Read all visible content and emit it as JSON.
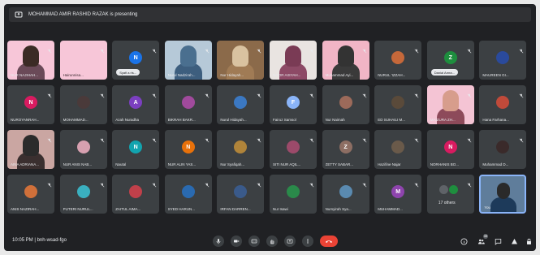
{
  "banner": {
    "text": "MOHAMMAD AMIR RASHID RAZAK is presenting"
  },
  "tiles": [
    {
      "name": "NUR NAJIHAH...",
      "kind": "video",
      "bg": "#f7c6d8",
      "face": "#3b2b25",
      "body": "#6a4a58"
    },
    {
      "name": "Hairunnisa...",
      "kind": "pink",
      "letter": "",
      "color": ""
    },
    {
      "name": "",
      "kind": "pill",
      "pill": "Syafi a ris...",
      "letter": "N",
      "color": "#1a73e8"
    },
    {
      "name": "Nurul Nadzirah...",
      "kind": "video",
      "bg": "#b6c9d8",
      "face": "#4a6f8f",
      "body": "#3d5e7e"
    },
    {
      "name": "Nur Hidayah...",
      "kind": "video",
      "bg": "#8b6a4a",
      "face": "#d9c2a0",
      "body": "#a07b55"
    },
    {
      "name": "NOOR AISYAH...",
      "kind": "video",
      "bg": "#e9e4e1",
      "face": "#7a3b55",
      "body": "#8d4a66"
    },
    {
      "name": "Muhammad Ayi...",
      "kind": "video",
      "bg": "#f1b5c6",
      "face": "#333",
      "body": "#3a3a3a"
    },
    {
      "name": "NURUL 'IZZAH...",
      "kind": "avatar",
      "letter": "",
      "color": "#c5683a"
    },
    {
      "name": "",
      "kind": "pill",
      "pill": "Danial Amra...",
      "letter": "Z",
      "color": "#1e8e3e"
    },
    {
      "name": "MAUREEN GI...",
      "kind": "avatar",
      "letter": "",
      "color": "#2a4a9c"
    },
    {
      "name": "NUROYANRAH...",
      "kind": "avatar",
      "letter": "N",
      "color": "#d81b60"
    },
    {
      "name": "MOHAMMAD...",
      "kind": "avatar",
      "letter": "",
      "color": "#4a3a3a"
    },
    {
      "name": "Azah Nuradha",
      "kind": "avatar",
      "letter": "A",
      "color": "#7b3fc0"
    },
    {
      "name": "BIKRAH BAKR...",
      "kind": "avatar",
      "letter": "",
      "color": "#a04a9c"
    },
    {
      "name": "Nurul Hidayah...",
      "kind": "avatar",
      "letter": "",
      "color": "#3b78c2"
    },
    {
      "name": "Fairuz Samsol",
      "kind": "avatar",
      "letter": "F",
      "color": "#8ab4f8"
    },
    {
      "name": "Nur Naimah",
      "kind": "avatar",
      "letter": "",
      "color": "#9c6a5a"
    },
    {
      "name": "ED SUHAILI M...",
      "kind": "avatar",
      "letter": "",
      "color": "#5a4a3a"
    },
    {
      "name": "MAIZURA ZH...",
      "kind": "video",
      "bg": "#f4c4d4",
      "face": "#d79d8c",
      "body": "#8d4a5a"
    },
    {
      "name": "Hana Farhana...",
      "kind": "avatar",
      "letter": "",
      "color": "#c04a3a"
    },
    {
      "name": "AINA ADRIANA...",
      "kind": "video",
      "bg": "#caa6a2",
      "face": "#2b2b2b",
      "body": "#3a2f2f"
    },
    {
      "name": "NUR ANIS NAB...",
      "kind": "avatar",
      "letter": "",
      "color": "#d7a0b0"
    },
    {
      "name": "Nautal",
      "kind": "avatar",
      "letter": "N",
      "color": "#12a4af"
    },
    {
      "name": "NUR ALIN YAS...",
      "kind": "avatar",
      "letter": "N",
      "color": "#e8710a"
    },
    {
      "name": "Nur Syafiqah...",
      "kind": "avatar",
      "letter": "",
      "color": "#b0843a"
    },
    {
      "name": "SITI NUR AQIL...",
      "kind": "avatar",
      "letter": "",
      "color": "#9c4a6a"
    },
    {
      "name": "ZETTY SABAR...",
      "kind": "avatar",
      "letter": "Z",
      "color": "#8d6e63"
    },
    {
      "name": "Hazifine Najar",
      "kind": "avatar",
      "letter": "",
      "color": "#6a5a4a"
    },
    {
      "name": "NORHANIS BO...",
      "kind": "avatar",
      "letter": "N",
      "color": "#d81b60"
    },
    {
      "name": "Muhammad D...",
      "kind": "avatar",
      "letter": "",
      "color": "#3a2a2a"
    },
    {
      "name": "ANIS NAZIRAH...",
      "kind": "avatar",
      "letter": "",
      "color": "#d0703a"
    },
    {
      "name": "PUTERI NURUL...",
      "kind": "avatar",
      "letter": "",
      "color": "#3ab0c0"
    },
    {
      "name": "ZAITUL AIMA...",
      "kind": "avatar",
      "letter": "",
      "color": "#c0404a"
    },
    {
      "name": "SYED HARUN...",
      "kind": "avatar",
      "letter": "",
      "color": "#2a6ab0"
    },
    {
      "name": "IRFAN DARREN...",
      "kind": "avatar",
      "letter": "",
      "color": "#3a5a8a"
    },
    {
      "name": "Nur Isawi",
      "kind": "avatar",
      "letter": "",
      "color": "#2a8a4a"
    },
    {
      "name": "Nursyirah Sya...",
      "kind": "avatar",
      "letter": "",
      "color": "#5a8ab0"
    },
    {
      "name": "MUHAMMAD...",
      "kind": "avatar",
      "letter": "M",
      "color": "#8e44ad"
    },
    {
      "name": "17 others",
      "kind": "others"
    },
    {
      "name": "You",
      "kind": "self"
    }
  ],
  "bottombar": {
    "time": "10:05 PM",
    "separator": "|",
    "code": "bnh-wsad-fgo"
  },
  "controls": [
    "mic-icon",
    "camera-icon",
    "captions-icon",
    "raise-hand-icon",
    "present-icon",
    "more-icon"
  ],
  "right_controls": [
    "info-icon",
    "people-icon",
    "chat-icon",
    "activities-icon",
    "lock-icon"
  ],
  "people_badge": "39"
}
